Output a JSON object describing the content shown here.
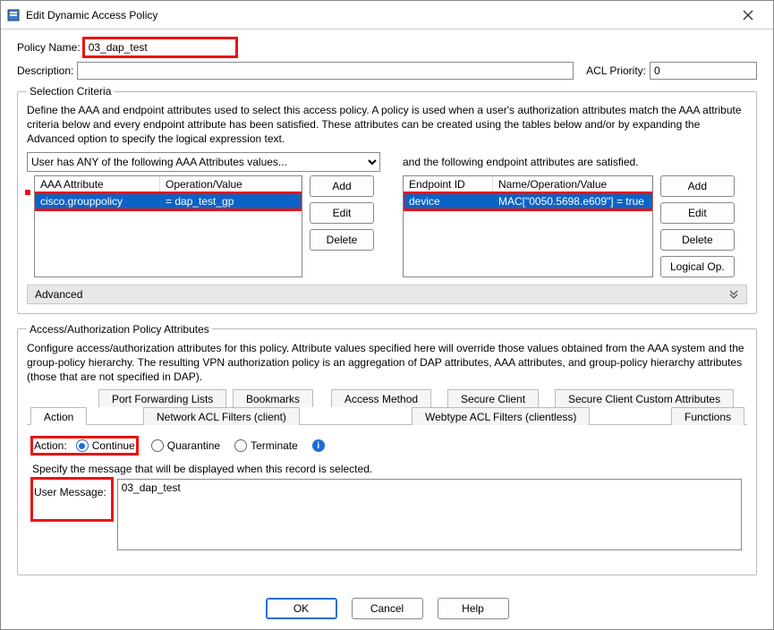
{
  "window": {
    "title": "Edit Dynamic Access Policy"
  },
  "header": {
    "policy_name_label": "Policy Name:",
    "policy_name_value": "03_dap_test",
    "description_label": "Description:",
    "description_value": "",
    "acl_priority_label": "ACL Priority:",
    "acl_priority_value": "0"
  },
  "selection": {
    "legend": "Selection Criteria",
    "desc": "Define the AAA and endpoint attributes used to select this access policy. A policy is used when a user's authorization attributes match the AAA attribute criteria below and every endpoint attribute has been satisfied. These attributes can be created using the tables below and/or by expanding the Advanced option to specify the logical expression text.",
    "aaa_select": "User has ANY of the following AAA Attributes values...",
    "and_text": "and the following endpoint attributes are satisfied.",
    "aaa_headers": {
      "c1": "AAA Attribute",
      "c2": "Operation/Value"
    },
    "aaa_rows": [
      {
        "attr": "cisco.grouppolicy",
        "op": "=   dap_test_gp"
      }
    ],
    "ep_headers": {
      "c1": "Endpoint ID",
      "c2": "Name/Operation/Value"
    },
    "ep_rows": [
      {
        "id": "device",
        "val": "MAC[\"0050.5698.e609\"]  =  true"
      }
    ],
    "buttons": {
      "add": "Add",
      "edit": "Edit",
      "delete": "Delete",
      "logical": "Logical Op."
    },
    "advanced": "Advanced"
  },
  "policy": {
    "legend": "Access/Authorization Policy Attributes",
    "desc": "Configure access/authorization attributes for this policy. Attribute values specified here will override those values obtained from the AAA system and the group-policy hierarchy. The resulting VPN authorization policy is an aggregation of DAP attributes, AAA attributes, and group-policy hierarchy attributes (those that are not specified in DAP).",
    "tabs_top": [
      "Port Forwarding Lists",
      "Bookmarks",
      "Access Method",
      "Secure Client",
      "Secure Client Custom Attributes"
    ],
    "tabs_bottom": [
      "Action",
      "Network ACL Filters (client)",
      "Webtype ACL Filters (clientless)",
      "Functions"
    ],
    "action_label": "Action:",
    "radios": {
      "continue": "Continue",
      "quarantine": "Quarantine",
      "terminate": "Terminate"
    },
    "msg_prompt": "Specify the message that will be displayed when this record is selected.",
    "user_msg_label": "User Message:",
    "user_msg_value": "03_dap_test"
  },
  "footer": {
    "ok": "OK",
    "cancel": "Cancel",
    "help": "Help"
  }
}
